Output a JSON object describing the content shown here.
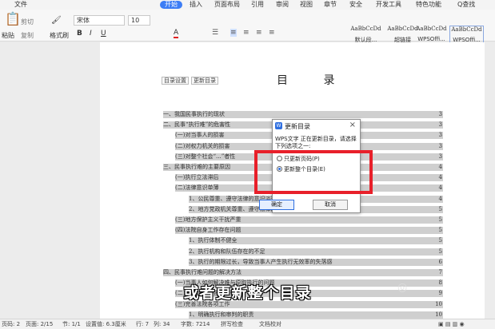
{
  "menubar": {
    "file": "文件",
    "start": "开始",
    "insert": "插入",
    "layout": "页面布局",
    "ref": "引用",
    "review": "审阅",
    "view": "视图",
    "section": "章节",
    "security": "安全",
    "devtools": "开发工具",
    "special": "特色功能",
    "search": "Q查找"
  },
  "toolbar": {
    "paste": "粘贴",
    "cut": "剪切",
    "copy": "复制",
    "format_painter": "格式刷",
    "font_name": "宋体",
    "font_size": "10",
    "bold": "B",
    "italic": "I",
    "underline": "U",
    "font_color": "A",
    "styles": [
      {
        "preview": "AaBbCcDd",
        "name": "默认段..."
      },
      {
        "preview": "AaBbCcDd",
        "name": "超链接"
      },
      {
        "preview": "AaBbCcDd",
        "name": "WPSOffi..."
      },
      {
        "preview": "AaBbCcDd",
        "name": "WPSOffi..."
      }
    ]
  },
  "toc": {
    "toolbar_settings": "目录设置",
    "toolbar_update": "更新目录",
    "title": "目 录",
    "lines": [
      {
        "text": "一、我国民事执行的现状",
        "page": "3"
      },
      {
        "text": "二、民事“执行难”的危害性",
        "page": "3"
      },
      {
        "text": "(一)对当事人的损害",
        "page": "3"
      },
      {
        "text": "(二)对权力机关的损害",
        "page": "3"
      },
      {
        "text": "(三)对整个社会“...”者性",
        "page": "3"
      },
      {
        "text": "三、民事执行难的主要原因",
        "page": "4"
      },
      {
        "text": "(一)执行立法滞后",
        "page": "4"
      },
      {
        "text": "(二)法律意识单薄",
        "page": "4"
      },
      {
        "text": "1、公民尊重、遵守法律的意识淡薄",
        "page": "4"
      },
      {
        "text": "2、地方党政机关尊重、遵守法律的意识单薄",
        "page": "5"
      },
      {
        "text": "(三)地方保护主义干扰严重",
        "page": "5"
      },
      {
        "text": "(四)法院自身工作存在问题",
        "page": "5"
      },
      {
        "text": "1、执行体制不健全",
        "page": "5"
      },
      {
        "text": "2、执行机构和队伍存在的不足",
        "page": "5"
      },
      {
        "text": "3、执行的期限过长，导致当事人产生执行无效率的失落感",
        "page": "6"
      },
      {
        "text": "四、民事执行难问题的解决方法",
        "page": "7"
      },
      {
        "text": "(一)当事人如何解决难与原取执行的问题",
        "page": "8"
      },
      {
        "text": "(二)制定统一的强制执行法",
        "page": "9"
      },
      {
        "text": "(三)完善法院各项工作",
        "page": "10"
      },
      {
        "text": "1、明确执行和审判的职责",
        "page": "10"
      }
    ]
  },
  "dialog": {
    "title": "更新目录",
    "message": "WPS文字 正在更新目录，请选择下列选项之一:",
    "option1": "只更新页码(P)",
    "option2": "更新整个目录(E)",
    "ok": "确定",
    "cancel": "取消",
    "close": "×"
  },
  "subtitle": "或者更新整个目录",
  "status": {
    "page_num": "页码: 2",
    "pages": "页面: 2/15",
    "section": "节: 1/1",
    "setting": "设置值: 6.3厘米",
    "row": "行: 7",
    "col": "列: 34",
    "words": "字数: 7214",
    "spell": "拼写检查",
    "doc_check": "文档校对"
  },
  "colors": {
    "accent": "#3c7df5",
    "highlight": "#e8202a"
  }
}
